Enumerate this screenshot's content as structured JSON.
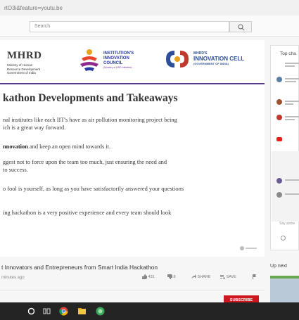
{
  "browser": {
    "url": "rtO3i&feature=youtu.be"
  },
  "youtube": {
    "search_placeholder": "Search"
  },
  "slide": {
    "mhrd": {
      "name": "MHRD",
      "subtitle_lines": [
        "Ministry of Human",
        "Resource Development",
        "Government of India"
      ]
    },
    "iic": {
      "lines": [
        "INSTITUTION'S",
        "INNOVATION",
        "COUNCIL"
      ],
      "sub": "(Ministry of HRD Initiative)"
    },
    "innovation_cell": {
      "small": "MHRD'S",
      "big": "INNOVATION CELL",
      "sub": "(GOVERNMENT OF INDIA)"
    },
    "title": "kathon Developments and Takeaways",
    "para1_line1": "nal institutes like each IIT's have as air pollution monitoring project being",
    "para1_line2": "ich is a great way forward.",
    "para2_bold": "nnovation",
    "para2_rest": " and keep an open mind towards it.",
    "para3_line1": "ggest not to force upon the team too much, just ensuring the need and",
    "para3_line2": " to success.",
    "para4": "o fool is yourself, as long as you have satisfactorily answered your questions",
    "para5": "ing hackathon is a very positive experience and every team should look"
  },
  "video": {
    "title": "t Innovators and Entrepreneurs from Smart India Hackathon",
    "date": "minutes ago",
    "likes": "431",
    "dislikes": "8",
    "share": "SHARE",
    "save": "SAVE",
    "subscribe": "SUBSCRIBE"
  },
  "chat": {
    "title": "Top cha",
    "input_placeholder": "Say some"
  },
  "sidebar": {
    "up_next": "Up next"
  },
  "taskbar": {
    "icons": [
      "windows-icon",
      "search-icon",
      "task-view-icon",
      "chrome-icon",
      "file-explorer-icon",
      "app-icon"
    ]
  },
  "colors": {
    "accent_purple": "#5a3d8f",
    "youtube_red": "#cc181e"
  }
}
